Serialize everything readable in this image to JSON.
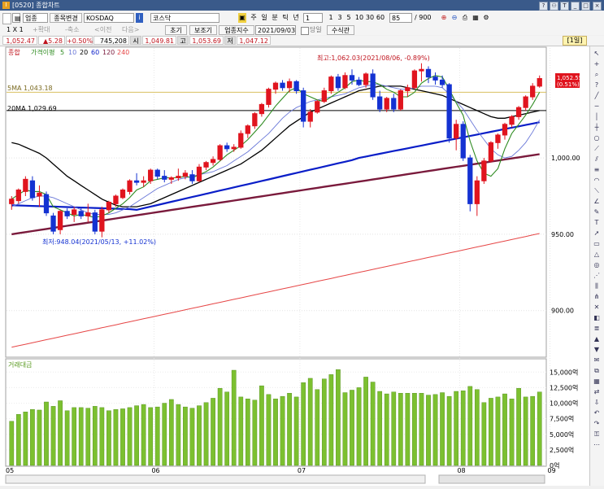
{
  "window": {
    "title": "[0520] 종합차트",
    "title_icon": "I"
  },
  "toolbar": {
    "market": "업종",
    "search_btn": "종목변경",
    "symbol": "KOSDAQ",
    "name": "코스닥",
    "periods": [
      "주",
      "일",
      "분",
      "틱",
      "년"
    ],
    "tick_value": "1",
    "intervals": [
      "1",
      "3",
      "5",
      "10",
      "30",
      "60"
    ],
    "count_value": "85",
    "total": "/ 900"
  },
  "toolbar2": {
    "layout": "1 X 1",
    "buttons": [
      "초기화",
      "보조기능",
      "업종지수"
    ],
    "date": "2021/09/03",
    "checkbox_label": "당일",
    "formula_btn": "수식관리"
  },
  "quote": {
    "last": "1,052.47",
    "change": "▲5.28",
    "change_pct": "+0.50%",
    "volume": "745,208",
    "open_label": "시",
    "open": "1,049.81",
    "high_label": "고",
    "high": "1,053.69",
    "low_label": "저",
    "low": "1,047.12",
    "period_tag": "[1일]"
  },
  "legend": {
    "main": "종합",
    "ma_title": "가격이평",
    "ma_items": [
      "5",
      "10",
      "20",
      "60",
      "120",
      "240"
    ],
    "volume_title": "거래대금"
  },
  "annotations": {
    "high_label": "최고:1,062.03(2021/08/06, -0.89%)",
    "low_label": "최저:948.04(2021/05/13, +11.02%)",
    "ma5_label": "5MA 1,043.18",
    "ma20_label": "20MA 1,029.69",
    "price_flag": "1,052.55",
    "price_flag_pct": "(0.51%)"
  },
  "price_axis": [
    "1,000.00",
    "950.00",
    "900.00"
  ],
  "volume_axis": [
    "15,000억",
    "12,500억",
    "10,000억",
    "7,500억",
    "5,000억",
    "2,500억",
    "0억"
  ],
  "month_axis": [
    "05",
    "06",
    "07",
    "08",
    "09"
  ],
  "colors": {
    "up": "#e0141e",
    "down": "#1432d2",
    "ma5": "#2e8b20",
    "ma10": "#6a78d8",
    "ma20": "#000000",
    "ma60": "#0a1ec8",
    "ma120": "#7a1a3c",
    "ma240": "#e64646",
    "volume": "#7cc030",
    "hline5": "#d8c060"
  },
  "chart_data": {
    "type": "candlestick",
    "price_ylim": [
      870,
      1072
    ],
    "volume_ylim": [
      0,
      17000
    ],
    "candles": [
      {
        "o": 970.0,
        "h": 975.0,
        "l": 966.0,
        "c": 973.0
      },
      {
        "o": 972.0,
        "h": 980.0,
        "l": 970.0,
        "c": 979.0
      },
      {
        "o": 978.0,
        "h": 988.0,
        "l": 975.0,
        "c": 986.0
      },
      {
        "o": 985.0,
        "h": 988.0,
        "l": 972.0,
        "c": 974.0
      },
      {
        "o": 975.0,
        "h": 982.0,
        "l": 968.0,
        "c": 977.0
      },
      {
        "o": 976.0,
        "h": 978.0,
        "l": 962.0,
        "c": 964.0
      },
      {
        "o": 962.0,
        "h": 964.0,
        "l": 950.0,
        "c": 952.0
      },
      {
        "o": 953.0,
        "h": 966.0,
        "l": 950.0,
        "c": 965.0
      },
      {
        "o": 965.0,
        "h": 967.0,
        "l": 960.0,
        "c": 962.0
      },
      {
        "o": 963.0,
        "h": 968.0,
        "l": 958.0,
        "c": 966.0
      },
      {
        "o": 965.0,
        "h": 968.0,
        "l": 960.0,
        "c": 962.0
      },
      {
        "o": 962.0,
        "h": 970.0,
        "l": 958.0,
        "c": 964.0
      },
      {
        "o": 964.0,
        "h": 966.0,
        "l": 950.0,
        "c": 952.0
      },
      {
        "o": 952.0,
        "h": 968.0,
        "l": 948.0,
        "c": 966.0
      },
      {
        "o": 966.0,
        "h": 972.0,
        "l": 964.0,
        "c": 971.0
      },
      {
        "o": 970.0,
        "h": 976.0,
        "l": 968.0,
        "c": 975.0
      },
      {
        "o": 974.0,
        "h": 980.0,
        "l": 973.0,
        "c": 979.0
      },
      {
        "o": 978.0,
        "h": 986.0,
        "l": 976.0,
        "c": 985.0
      },
      {
        "o": 985.0,
        "h": 990.0,
        "l": 982.0,
        "c": 984.0
      },
      {
        "o": 984.0,
        "h": 988.0,
        "l": 981.0,
        "c": 985.0
      },
      {
        "o": 985.0,
        "h": 993.0,
        "l": 983.0,
        "c": 992.0
      },
      {
        "o": 992.0,
        "h": 993.0,
        "l": 986.0,
        "c": 988.0
      },
      {
        "o": 988.0,
        "h": 992.0,
        "l": 984.0,
        "c": 986.0
      },
      {
        "o": 986.0,
        "h": 988.0,
        "l": 983.0,
        "c": 987.0
      },
      {
        "o": 987.0,
        "h": 993.0,
        "l": 985.0,
        "c": 988.0
      },
      {
        "o": 988.0,
        "h": 992.0,
        "l": 986.0,
        "c": 990.0
      },
      {
        "o": 989.0,
        "h": 992.0,
        "l": 983.0,
        "c": 985.0
      },
      {
        "o": 985.0,
        "h": 996.0,
        "l": 984.0,
        "c": 994.0
      },
      {
        "o": 994.0,
        "h": 998.0,
        "l": 992.0,
        "c": 997.0
      },
      {
        "o": 997.0,
        "h": 1001.0,
        "l": 995.0,
        "c": 999.0
      },
      {
        "o": 999.0,
        "h": 1009.0,
        "l": 998.0,
        "c": 1008.0
      },
      {
        "o": 1008.0,
        "h": 1010.0,
        "l": 1004.0,
        "c": 1006.0
      },
      {
        "o": 1006.0,
        "h": 1009.0,
        "l": 1004.0,
        "c": 1007.0
      },
      {
        "o": 1007.0,
        "h": 1018.0,
        "l": 1006.0,
        "c": 1016.0
      },
      {
        "o": 1016.0,
        "h": 1022.0,
        "l": 1013.0,
        "c": 1021.0
      },
      {
        "o": 1021.0,
        "h": 1030.0,
        "l": 1019.0,
        "c": 1029.0
      },
      {
        "o": 1029.0,
        "h": 1036.0,
        "l": 1027.0,
        "c": 1035.0
      },
      {
        "o": 1035.0,
        "h": 1046.0,
        "l": 1033.0,
        "c": 1045.0
      },
      {
        "o": 1045.0,
        "h": 1050.0,
        "l": 1042.0,
        "c": 1049.0
      },
      {
        "o": 1049.0,
        "h": 1051.0,
        "l": 1044.0,
        "c": 1046.0
      },
      {
        "o": 1046.0,
        "h": 1052.0,
        "l": 1043.0,
        "c": 1050.0
      },
      {
        "o": 1050.0,
        "h": 1051.0,
        "l": 1042.0,
        "c": 1044.0
      },
      {
        "o": 1044.0,
        "h": 1046.0,
        "l": 1020.0,
        "c": 1024.0
      },
      {
        "o": 1024.0,
        "h": 1032.0,
        "l": 1020.0,
        "c": 1030.0
      },
      {
        "o": 1030.0,
        "h": 1038.0,
        "l": 1029.0,
        "c": 1037.0
      },
      {
        "o": 1037.0,
        "h": 1046.0,
        "l": 1036.0,
        "c": 1044.0
      },
      {
        "o": 1044.0,
        "h": 1054.0,
        "l": 1042.0,
        "c": 1053.0
      },
      {
        "o": 1053.0,
        "h": 1055.0,
        "l": 1044.0,
        "c": 1046.0
      },
      {
        "o": 1046.0,
        "h": 1056.0,
        "l": 1045.0,
        "c": 1054.0
      },
      {
        "o": 1054.0,
        "h": 1058.0,
        "l": 1048.0,
        "c": 1051.0
      },
      {
        "o": 1051.0,
        "h": 1053.0,
        "l": 1047.0,
        "c": 1048.0
      },
      {
        "o": 1048.0,
        "h": 1056.0,
        "l": 1046.0,
        "c": 1055.0
      },
      {
        "o": 1055.0,
        "h": 1058.0,
        "l": 1038.0,
        "c": 1040.0
      },
      {
        "o": 1040.0,
        "h": 1044.0,
        "l": 1030.0,
        "c": 1032.0
      },
      {
        "o": 1032.0,
        "h": 1040.0,
        "l": 1030.0,
        "c": 1039.0
      },
      {
        "o": 1039.0,
        "h": 1042.0,
        "l": 1030.0,
        "c": 1032.0
      },
      {
        "o": 1032.0,
        "h": 1045.0,
        "l": 1031.0,
        "c": 1044.0
      },
      {
        "o": 1044.0,
        "h": 1048.0,
        "l": 1040.0,
        "c": 1046.0
      },
      {
        "o": 1046.0,
        "h": 1058.0,
        "l": 1045.0,
        "c": 1057.0
      },
      {
        "o": 1057.0,
        "h": 1062.0,
        "l": 1050.0,
        "c": 1058.0
      },
      {
        "o": 1058.0,
        "h": 1060.0,
        "l": 1049.0,
        "c": 1053.0
      },
      {
        "o": 1053.0,
        "h": 1056.0,
        "l": 1048.0,
        "c": 1051.0
      },
      {
        "o": 1051.0,
        "h": 1054.0,
        "l": 1046.0,
        "c": 1048.0
      },
      {
        "o": 1048.0,
        "h": 1049.0,
        "l": 1010.0,
        "c": 1013.0
      },
      {
        "o": 1013.0,
        "h": 1025.0,
        "l": 1005.0,
        "c": 1022.0
      },
      {
        "o": 1022.0,
        "h": 1024.0,
        "l": 998.0,
        "c": 1000.0
      },
      {
        "o": 1000.0,
        "h": 1002.0,
        "l": 965.0,
        "c": 970.0
      },
      {
        "o": 970.0,
        "h": 988.0,
        "l": 962.0,
        "c": 985.0
      },
      {
        "o": 985.0,
        "h": 1000.0,
        "l": 983.0,
        "c": 998.0
      },
      {
        "o": 998.0,
        "h": 1011.0,
        "l": 997.0,
        "c": 1010.0
      },
      {
        "o": 1010.0,
        "h": 1016.0,
        "l": 1006.0,
        "c": 1015.0
      },
      {
        "o": 1015.0,
        "h": 1023.0,
        "l": 1012.0,
        "c": 1022.0
      },
      {
        "o": 1022.0,
        "h": 1028.0,
        "l": 1020.0,
        "c": 1027.0
      },
      {
        "o": 1027.0,
        "h": 1034.0,
        "l": 1025.0,
        "c": 1033.0
      },
      {
        "o": 1033.0,
        "h": 1041.0,
        "l": 1031.0,
        "c": 1040.0
      },
      {
        "o": 1040.0,
        "h": 1049.0,
        "l": 1038.0,
        "c": 1047.0
      },
      {
        "o": 1047.0,
        "h": 1054.0,
        "l": 1046.0,
        "c": 1052.0
      }
    ],
    "volume": [
      7100,
      8200,
      8600,
      9000,
      8900,
      10200,
      9500,
      10400,
      8800,
      9300,
      9300,
      9200,
      9500,
      9300,
      8800,
      9000,
      9100,
      9300,
      9600,
      9800,
      9300,
      9400,
      10000,
      10600,
      9800,
      9400,
      9200,
      9600,
      10100,
      10800,
      12400,
      11800,
      15300,
      11000,
      10700,
      10500,
      12800,
      11400,
      10700,
      11100,
      11600,
      11000,
      13300,
      14000,
      12200,
      13900,
      14600,
      15400,
      11700,
      12100,
      12500,
      14200,
      13400,
      11900,
      11500,
      11800,
      11600,
      11600,
      11600,
      11600,
      11300,
      11400,
      11700,
      11100,
      11900,
      12000,
      12700,
      12200,
      10100,
      10800,
      11000,
      11500,
      10700,
      12400,
      11000,
      11100,
      11800,
      12300,
      13000,
      11000,
      6100
    ],
    "ma": {
      "ma5": [
        973,
        976,
        979,
        978,
        978,
        976,
        968,
        966,
        964,
        962,
        963,
        962,
        961,
        962,
        964,
        967,
        970,
        974,
        979,
        981,
        985,
        986,
        987,
        987,
        987,
        988,
        987,
        989,
        991,
        994,
        998,
        1002,
        1005,
        1008,
        1012,
        1017,
        1022,
        1028,
        1034,
        1039,
        1044,
        1046,
        1042,
        1040,
        1038,
        1037,
        1040,
        1043,
        1046,
        1050,
        1051,
        1050,
        1050,
        1048,
        1045,
        1043,
        1040,
        1040,
        1043,
        1049,
        1052,
        1054,
        1053,
        1045,
        1036,
        1028,
        1011,
        998,
        990,
        988,
        993,
        1006,
        1016,
        1022,
        1028,
        1035,
        1043
      ],
      "ma10": [
        968,
        970,
        972,
        974,
        975,
        975,
        974,
        972,
        970,
        968,
        966,
        964,
        963,
        963,
        963,
        964,
        966,
        968,
        971,
        974,
        977,
        980,
        982,
        984,
        986,
        987,
        988,
        989,
        990,
        991,
        993,
        995,
        998,
        1001,
        1004,
        1008,
        1012,
        1016,
        1021,
        1026,
        1030,
        1033,
        1035,
        1037,
        1038,
        1039,
        1040,
        1041,
        1042,
        1044,
        1046,
        1047,
        1048,
        1048,
        1047,
        1046,
        1045,
        1045,
        1046,
        1047,
        1047,
        1047,
        1046,
        1042,
        1037,
        1032,
        1025,
        1018,
        1012,
        1006,
        1002,
        1000,
        1001,
        1005,
        1010,
        1017,
        1025
      ],
      "ma20": [
        1010,
        1009,
        1007,
        1005,
        1003,
        1000,
        996,
        992,
        988,
        985,
        982,
        979,
        976,
        973,
        971,
        969,
        968,
        968,
        968,
        969,
        970,
        972,
        974,
        976,
        978,
        980,
        982,
        984,
        986,
        988,
        990,
        992,
        994,
        996,
        999,
        1002,
        1005,
        1009,
        1013,
        1017,
        1021,
        1024,
        1027,
        1030,
        1032,
        1034,
        1036,
        1038,
        1040,
        1042,
        1044,
        1045,
        1046,
        1047,
        1047,
        1047,
        1047,
        1046,
        1045,
        1044,
        1043,
        1042,
        1041,
        1039,
        1037,
        1035,
        1033,
        1031,
        1029,
        1027,
        1026,
        1026,
        1027,
        1028,
        1029,
        1030,
        1031
      ]
    }
  }
}
